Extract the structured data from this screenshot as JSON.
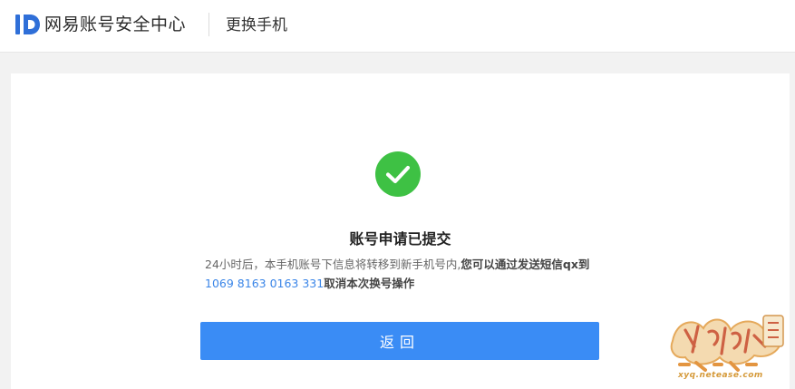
{
  "header": {
    "brand": "网易账号安全中心",
    "page_title": "更换手机"
  },
  "result": {
    "title": "账号申请已提交",
    "desc_part1": "24小时后，本手机账号下信息将转移到新手机号内,",
    "desc_strong1": "您可以通过发送短信qx到",
    "phone_number": "1069 8163 0163 331",
    "desc_strong2": "取消本次换号操作"
  },
  "actions": {
    "back_label": "返回"
  },
  "watermark": {
    "text": "xyq.netease.com",
    "logo_text": "梦幻西游 官方论坛"
  },
  "colors": {
    "accent": "#3a8cf5",
    "success": "#3ec144",
    "link": "#3b86e8",
    "logo": "#2f6fd8"
  }
}
